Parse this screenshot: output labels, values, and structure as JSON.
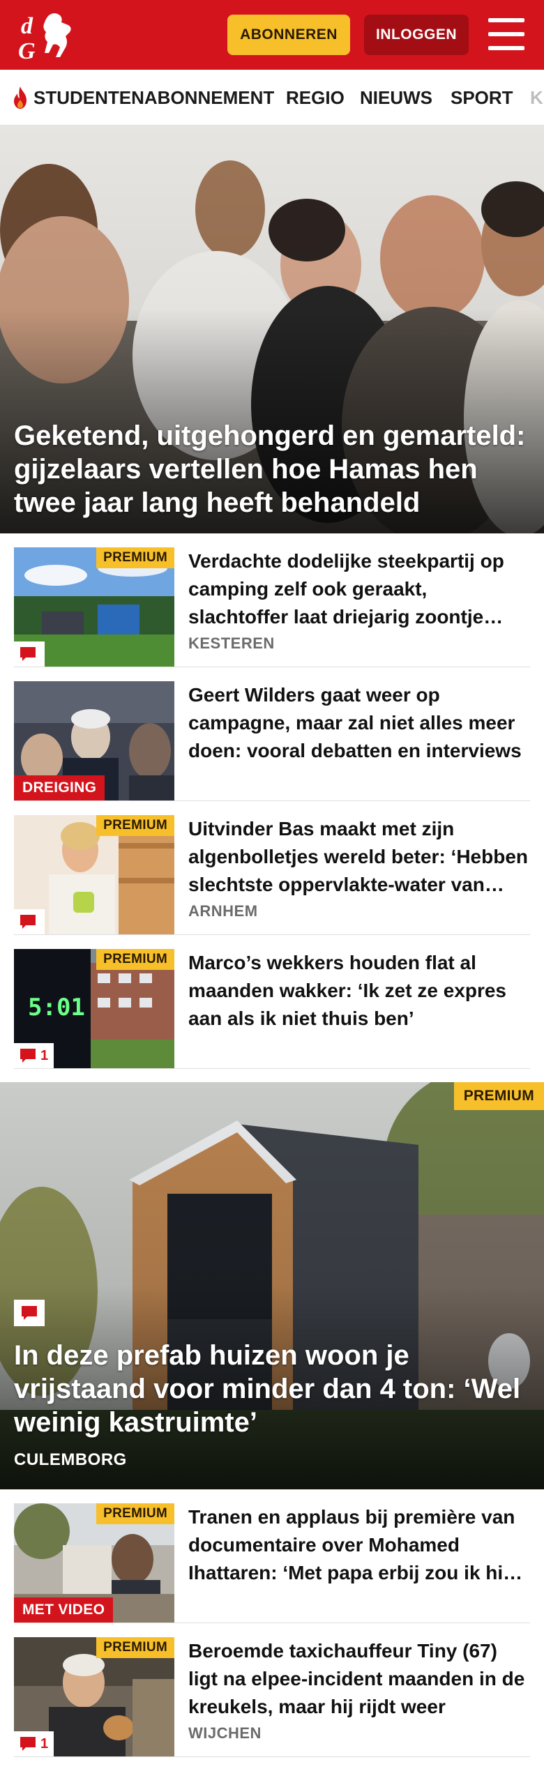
{
  "header": {
    "logo_text": "dG",
    "subscribe_label": "ABONNEREN",
    "login_label": "INLOGGEN",
    "brand_color": "#d4141c",
    "accent_color": "#f7c02b"
  },
  "nav": {
    "items": [
      {
        "label": "STUDENTENABONNEMENT",
        "icon": "flame-icon"
      },
      {
        "label": "REGIO"
      },
      {
        "label": "NIEUWS"
      },
      {
        "label": "SPORT"
      },
      {
        "label": "K"
      }
    ]
  },
  "hero": {
    "title": "Geketend, uitgehongerd en gemarteld: gijzelaars vertellen hoe Hamas hen twee jaar lang heeft behandeld"
  },
  "articles": [
    {
      "title": "Verdachte dodelijke steekpartij op camping zelf ook geraakt, slachtoffer laat driejarig zoontje achter",
      "location": "KESTEREN",
      "premium": "PREMIUM",
      "comments": ""
    },
    {
      "title": "Geert Wilders gaat weer op campagne, maar zal niet alles meer doen: vooral debatten en interviews",
      "label": "DREIGING"
    },
    {
      "title": "Uitvinder Bas maakt met zijn algenbolletjes wereld beter: ‘Hebben slechtste oppervlakte-water van Europa’",
      "location": "ARNHEM",
      "premium": "PREMIUM",
      "comments": ""
    },
    {
      "title": "Marco’s wekkers houden flat al maanden wakker: ‘Ik zet ze expres aan als ik niet thuis ben’",
      "premium": "PREMIUM",
      "comments": "1"
    }
  ],
  "feature": {
    "premium": "PREMIUM",
    "title": "In deze prefab huizen woon je vrijstaand voor minder dan 4 ton: ‘Wel weinig kastruimte’",
    "location": "CULEMBORG"
  },
  "articles2": [
    {
      "title": "Tranen en applaus bij première van documentaire over Mohamed Ihattaren: ‘Met papa erbij zou ik hier niet zitten’",
      "premium": "PREMIUM",
      "label": "MET VIDEO"
    },
    {
      "title": "Beroemde taxichauffeur Tiny (67) ligt na elpee-incident maanden in de kreukels, maar hij rijdt weer",
      "location": "WIJCHEN",
      "premium": "PREMIUM",
      "comments": "1"
    }
  ]
}
